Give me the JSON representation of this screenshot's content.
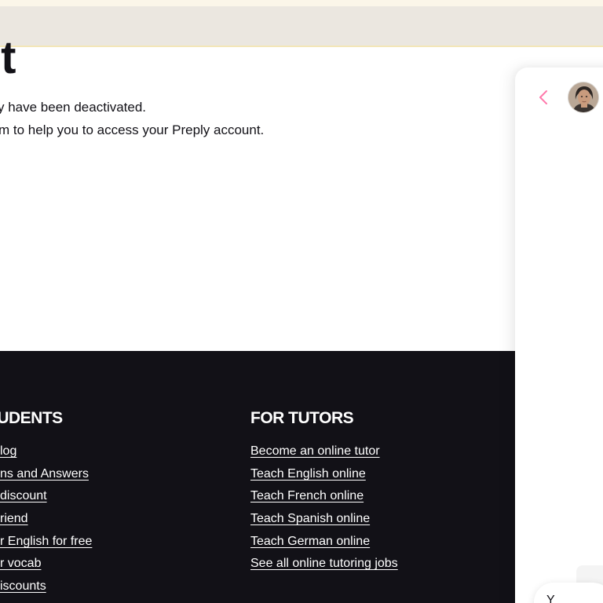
{
  "page": {
    "heading": "it",
    "messages": [
      "y have been deactivated.",
      "m to help you to access your Preply account."
    ]
  },
  "footer": {
    "students": {
      "title": "TUDENTS",
      "links": [
        "log",
        "ns and Answers",
        "discount",
        "riend",
        "r English for free",
        "r vocab",
        "iscounts"
      ]
    },
    "tutors": {
      "title": "FOR TUTORS",
      "links": [
        "Become an online tutor",
        "Teach English online",
        "Teach French online",
        "Teach Spanish online",
        "Teach German online",
        "See all online tutoring jobs"
      ]
    }
  },
  "chat_panel": {
    "back_icon": "chevron-left-icon",
    "accent_color": "#ff7aac",
    "bubble_text": "Y"
  },
  "colors": {
    "footer_bg": "#121117",
    "banner_bg": "#ebe7e0"
  }
}
